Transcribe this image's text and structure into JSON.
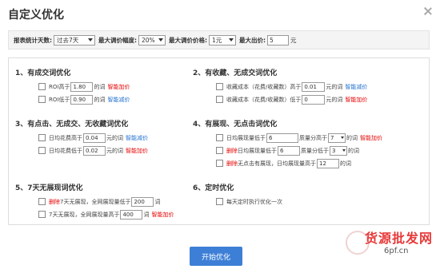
{
  "title": "自定义优化",
  "settings": {
    "days_label": "报表统计天数:",
    "days_value": "过去7天",
    "max_adjust_label": "最大调价幅度:",
    "max_adjust_value": "20%",
    "max_price_label": "最大调价价格:",
    "max_price_value": "1元",
    "max_bid_label": "最大出价:",
    "max_bid_value": "5",
    "max_bid_unit": "元"
  },
  "sections": {
    "s1": {
      "title": "1、有成交词优化",
      "r1": {
        "a": "ROI高于",
        "value": "1.80",
        "b": "的词",
        "tag": "智能加价"
      },
      "r2": {
        "a": "ROI低于",
        "value": "0.90",
        "b": "的词",
        "tag": "智能减价"
      }
    },
    "s2": {
      "title": "2、有收藏、无成交词优化",
      "r1": {
        "a": "收藏成本（花费/收藏数）高于",
        "value": "0.01",
        "b": "元的词",
        "tag": "智能减价"
      },
      "r2": {
        "a": "收藏成本（花费/收藏数）低于",
        "value": "0",
        "b": "元的词",
        "tag": "智能加价"
      }
    },
    "s3": {
      "title": "3、有点击、无成交、无收藏词优化",
      "r1": {
        "a": "日均花费高于",
        "value": "0.04",
        "b": "元的词",
        "tag": "智能减价"
      },
      "r2": {
        "a": "日均花费低于",
        "value": "0.02",
        "b": "元的词",
        "tag": "智能加价"
      }
    },
    "s4": {
      "title": "4、有展现、无点击词优化",
      "r1": {
        "a": "日均展现量低于",
        "value": "6",
        "b": "质量分高于",
        "select": "7",
        "c": "的词",
        "tag": "智能加价"
      },
      "r2": {
        "prefix": "删除",
        "a": "日均展现量低于",
        "value": "6",
        "b": "质量分低于",
        "select": "3",
        "c": "的词"
      },
      "r3": {
        "prefix": "删除",
        "a": "无点击有展现，日均展现量高于",
        "value": "12",
        "b": "的词"
      }
    },
    "s5": {
      "title": "5、7天无展现词优化",
      "r1": {
        "prefix": "删除",
        "a": "7天无展现，全网展现量低于",
        "value": "200",
        "b": "词"
      },
      "r2": {
        "a": "7天无展现，全网展现量高于",
        "value": "400",
        "b": "词",
        "tag": "智能加价"
      }
    },
    "s6": {
      "title": "6、定时优化",
      "r1": {
        "a": "每天定时执行优化一次"
      }
    }
  },
  "start_button": "开始优化",
  "watermark": {
    "text": "货源批发网",
    "url": "6pf.cn"
  },
  "colors": {
    "primary": "#3d7fd6",
    "increase": "#e60000",
    "decrease": "#1f6fd0"
  }
}
